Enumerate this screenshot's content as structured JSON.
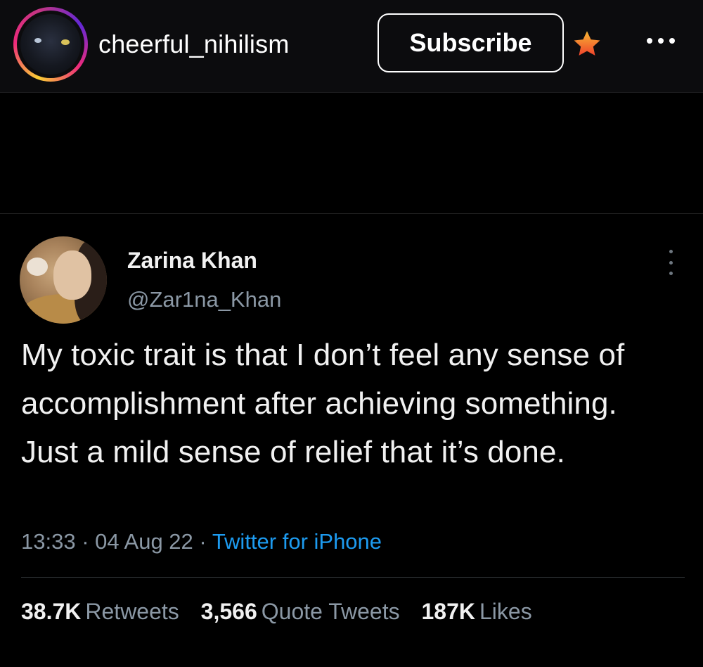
{
  "header": {
    "username": "cheerful_nihilism",
    "subscribe_label": "Subscribe",
    "star_icon": "star-icon",
    "more_icon": "more-horizontal-icon",
    "accent_star_color": "#f5a623"
  },
  "tweet": {
    "author_name": "Zarina Khan",
    "author_handle": "@Zar1na_Khan",
    "menu_icon": "more-vertical-icon",
    "text": "My toxic trait is that I don’t feel any sense of accomplishment after achieving something. Just a mild sense of relief that it’s done.",
    "time": "13:33",
    "date": "04 Aug 22",
    "separator": "·",
    "source": "Twitter for iPhone",
    "source_color": "#1d9bf0",
    "stats": [
      {
        "value": "38.7K",
        "label": "Retweets"
      },
      {
        "value": "3,566",
        "label": "Quote Tweets"
      },
      {
        "value": "187K",
        "label": "Likes"
      }
    ]
  }
}
